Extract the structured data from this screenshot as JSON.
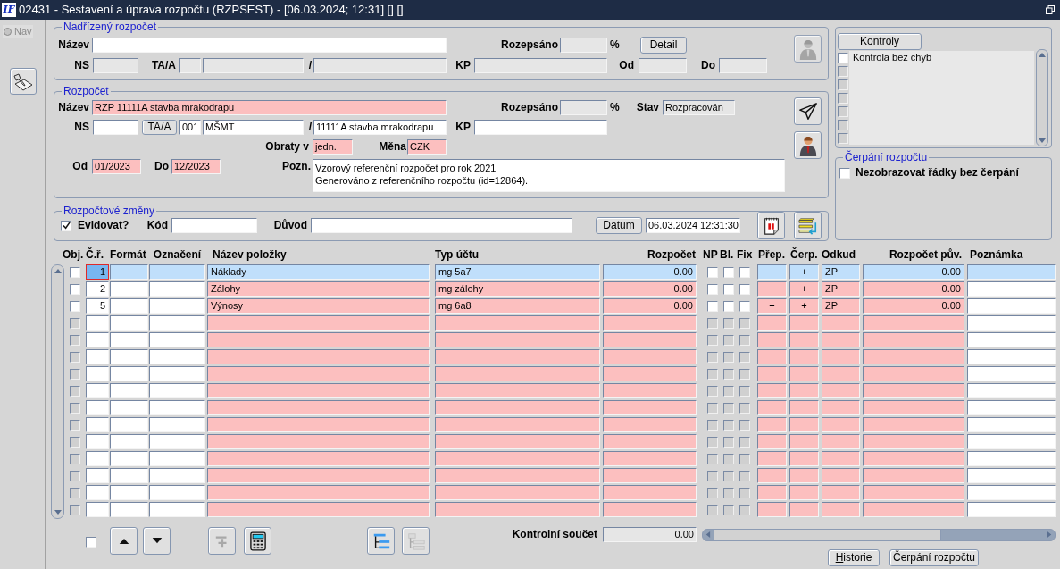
{
  "window": {
    "logo": "IF",
    "title": "02431 - Sestavení a úprava rozpočtu (RZPSEST) - [06.03.2024; 12:31] [] []"
  },
  "nav": {
    "label": "Nav",
    "selected": false
  },
  "parent_budget": {
    "legend": "Nadřízený rozpočet",
    "name_label": "Název",
    "rozepsano_label": "Rozepsáno",
    "percent": "%",
    "detail_button": "Detail",
    "ns_label": "NS",
    "taa_label": "TA/A",
    "slash": "/",
    "kp_label": "KP",
    "od_label": "Od",
    "do_label": "Do"
  },
  "budget": {
    "legend": "Rozpočet",
    "name_label": "Název",
    "name": "RZP 11111A stavba mrakodrapu",
    "rozepsano_label": "Rozepsáno",
    "percent": "%",
    "stav_label": "Stav",
    "stav": "Rozpracován",
    "ns_label": "NS",
    "taa_button": "TA/A",
    "ta_code": "001",
    "ta_name": "MŠMT",
    "slash": "/",
    "account": "11111A stavba mrakodrapu",
    "kp_label": "KP",
    "obraty_label": "Obraty v",
    "obraty": "jedn.",
    "mena_label": "Měna",
    "mena": "CZK",
    "od_label": "Od",
    "od": "01/2023",
    "do_label": "Do",
    "do": "12/2023",
    "pozn_label": "Pozn.",
    "pozn": "Vzorový referenční rozpočet pro rok 2021\nGenerováno z referenčního rozpočtu (id=12864)."
  },
  "changes": {
    "legend": "Rozpočtové změny",
    "evidovat": {
      "label": "Evidovat?",
      "checked": true
    },
    "kod_label": "Kód",
    "duvod_label": "Důvod",
    "datum_button": "Datum",
    "datum": "06.03.2024 12:31:30"
  },
  "checks": {
    "button": "Kontroly",
    "items": [
      {
        "label": "Kontrola bez chyb",
        "checked": false,
        "disabled": false
      },
      {
        "checked": false,
        "disabled": true
      },
      {
        "checked": false,
        "disabled": true
      },
      {
        "checked": false,
        "disabled": true
      },
      {
        "checked": false,
        "disabled": true
      },
      {
        "checked": false,
        "disabled": true
      },
      {
        "checked": false,
        "disabled": true
      }
    ]
  },
  "drawing": {
    "legend": "Čerpání rozpočtu",
    "hide_rows": {
      "label": "Nezobrazovat řádky bez čerpání",
      "checked": false
    }
  },
  "table": {
    "columns": [
      "Obj.",
      "Č.ř.",
      "Formát",
      "Označení",
      "Název položky",
      "Typ účtu",
      "Rozpočet",
      "NP",
      "Bl.",
      "Fix",
      "Přep.",
      "Čerp.",
      "Odkud",
      "Rozpočet pův.",
      "Poznámka"
    ],
    "rows": [
      {
        "selected": true,
        "disabled": false,
        "obj": false,
        "cr": "1",
        "nazev": "Náklady",
        "typ": "mg 5a7",
        "rozpocet": "0.00",
        "np": false,
        "bl": false,
        "fix": false,
        "prep": "+",
        "cerp": "+",
        "odkud": "ZP",
        "puvodni": "0.00"
      },
      {
        "selected": false,
        "disabled": false,
        "obj": false,
        "cr": "2",
        "nazev": "Zálohy",
        "typ": "mg zálohy",
        "rozpocet": "0.00",
        "np": false,
        "bl": false,
        "fix": false,
        "prep": "+",
        "cerp": "+",
        "odkud": "ZP",
        "puvodni": "0.00"
      },
      {
        "selected": false,
        "disabled": false,
        "obj": false,
        "cr": "5",
        "nazev": "Výnosy",
        "typ": "mg 6a8",
        "rozpocet": "0.00",
        "np": false,
        "bl": false,
        "fix": false,
        "prep": "+",
        "cerp": "+",
        "odkud": "ZP",
        "puvodni": "0.00"
      },
      {
        "selected": false,
        "disabled": true,
        "obj": false,
        "np": false,
        "bl": false,
        "fix": false
      },
      {
        "selected": false,
        "disabled": true,
        "obj": false,
        "np": false,
        "bl": false,
        "fix": false
      },
      {
        "selected": false,
        "disabled": true,
        "obj": false,
        "np": false,
        "bl": false,
        "fix": false
      },
      {
        "selected": false,
        "disabled": true,
        "obj": false,
        "np": false,
        "bl": false,
        "fix": false
      },
      {
        "selected": false,
        "disabled": true,
        "obj": false,
        "np": false,
        "bl": false,
        "fix": false
      },
      {
        "selected": false,
        "disabled": true,
        "obj": false,
        "np": false,
        "bl": false,
        "fix": false
      },
      {
        "selected": false,
        "disabled": true,
        "obj": false,
        "np": false,
        "bl": false,
        "fix": false
      },
      {
        "selected": false,
        "disabled": true,
        "obj": false,
        "np": false,
        "bl": false,
        "fix": false
      },
      {
        "selected": false,
        "disabled": true,
        "obj": false,
        "np": false,
        "bl": false,
        "fix": false
      },
      {
        "selected": false,
        "disabled": true,
        "obj": false,
        "np": false,
        "bl": false,
        "fix": false
      },
      {
        "selected": false,
        "disabled": true,
        "obj": false,
        "np": false,
        "bl": false,
        "fix": false
      },
      {
        "selected": false,
        "disabled": true,
        "obj": false,
        "np": false,
        "bl": false,
        "fix": false
      }
    ]
  },
  "footer": {
    "select_all": {
      "checked": false
    },
    "sum_label": "Kontrolní součet",
    "sum": "0.00",
    "buttons": [
      {
        "label": "Historie",
        "underline_first": true
      },
      {
        "label": "Čerpání rozpočtu",
        "underline_first": false
      }
    ]
  }
}
